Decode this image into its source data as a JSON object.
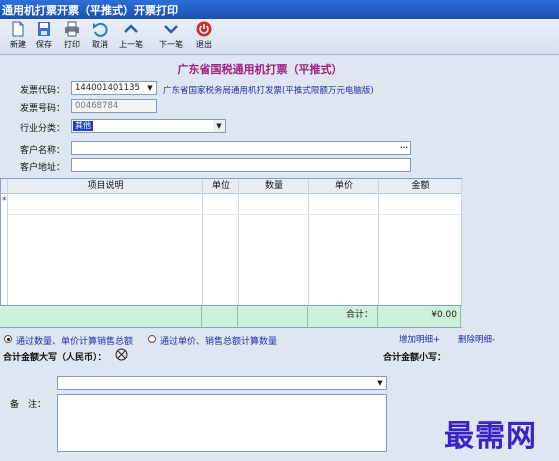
{
  "window": {
    "title": "通用机打票开票（平推式）开票打印"
  },
  "toolbar": {
    "new": "新建",
    "save": "保存",
    "print": "打印",
    "cancel": "取消",
    "prev": "上一笔",
    "next": "下一笔",
    "exit": "退出"
  },
  "form": {
    "title": "广东省国税通用机打票（平推式）",
    "invoice_code_label": "发票代码：",
    "invoice_code": "144001401135",
    "invoice_code_desc": "广东省国家税务局通用机打发票(平推式限额万元电脑版)",
    "invoice_no_label": "发票号码：",
    "invoice_no": "00468784",
    "industry_label": "行业分类：",
    "industry_value": "其他",
    "customer_name_label": "客户名称：",
    "customer_name": "",
    "customer_addr_label": "客户地址：",
    "customer_addr": "",
    "browse": "···"
  },
  "table": {
    "headers": [
      "项目说明",
      "单位",
      "数量",
      "单价",
      "金额"
    ],
    "new_row_marker": "*",
    "total_label": "合计：",
    "total_value": "¥0.00"
  },
  "options": {
    "by_qty": "通过数量、单价计算销售总额",
    "by_price": "通过单价、销售总额计算数量",
    "add_detail": "增加明细+",
    "del_detail": "删除明细-"
  },
  "summary": {
    "total_upper_label": "合计金额大写（人民币）：",
    "total_lower_label": "合计金额小写："
  },
  "remark": {
    "label": "备　注：",
    "value": ""
  },
  "watermark": "最需网"
}
